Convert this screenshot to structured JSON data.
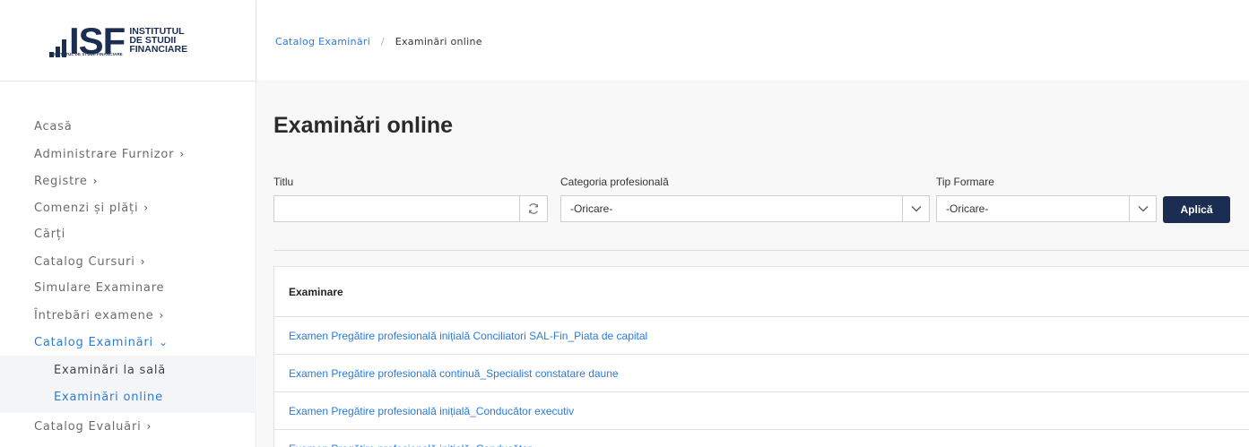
{
  "logo": {
    "mark": "ISF",
    "line1": "INSTITUTUL",
    "line2": "DE STUDII",
    "line3": "FINANCIARE",
    "subtitle": "INSTITUTUL DE STUDII FINANCIARE"
  },
  "breadcrumb": {
    "link": "Catalog Examinări",
    "separator": "/",
    "current": "Examinări online"
  },
  "sidebar": {
    "items": [
      {
        "label": "Acasă",
        "chevron": ""
      },
      {
        "label": "Administrare Furnizor",
        "chevron": "›"
      },
      {
        "label": "Registre",
        "chevron": "›"
      },
      {
        "label": "Comenzi și plăți",
        "chevron": "›"
      },
      {
        "label": "Cărți",
        "chevron": ""
      },
      {
        "label": "Catalog Cursuri",
        "chevron": "›"
      },
      {
        "label": "Simulare Examinare",
        "chevron": ""
      },
      {
        "label": "Întrebări examene",
        "chevron": "›"
      },
      {
        "label": "Catalog Examinări",
        "chevron": "⌄"
      },
      {
        "label": "Catalog Evaluări",
        "chevron": "›"
      }
    ],
    "submenu": [
      {
        "label": "Examinări la sală"
      },
      {
        "label": "Examinări online"
      }
    ]
  },
  "page": {
    "title": "Examinări online"
  },
  "filters": {
    "titlu_label": "Titlu",
    "titlu_value": "",
    "categorie_label": "Categoria profesională",
    "categorie_value": "-Oricare-",
    "tip_label": "Tip Formare",
    "tip_value": "-Oricare-",
    "apply_label": "Aplică"
  },
  "table": {
    "header": "Examinare",
    "rows": [
      "Examen Pregătire profesională inițială Conciliatori SAL-Fin_Piata de capital",
      "Examen Pregătire profesională continuă_Specialist constatare daune",
      "Examen Pregătire profesională inițială_Conducător executiv",
      "Examen Pregătire profesională inițială_Conducător"
    ]
  },
  "colors": {
    "accent": "#2b7bd9",
    "brand": "#1c2d52"
  },
  "icons": {
    "refresh": "refresh-icon",
    "select_chevron": "chevron-down-icon"
  }
}
